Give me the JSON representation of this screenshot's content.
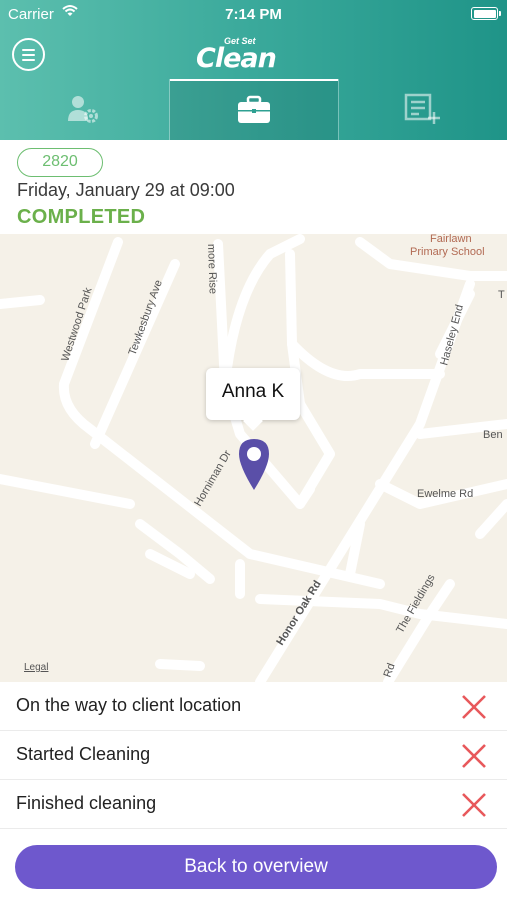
{
  "status_bar": {
    "carrier": "Carrier",
    "time": "7:14 PM"
  },
  "header": {
    "logo_small": "Get Set",
    "logo_big": "Clean",
    "tabs": [
      {
        "name": "profile-settings",
        "icon": "user-gear-icon",
        "active": false
      },
      {
        "name": "jobs",
        "icon": "briefcase-icon",
        "active": true
      },
      {
        "name": "new-entry",
        "icon": "document-add-icon",
        "active": false
      }
    ]
  },
  "order": {
    "id": "2820",
    "datetime": "Friday, January 29 at 09:00",
    "status": "COMPLETED"
  },
  "map": {
    "callout_name": "Anna K",
    "legal": "Legal",
    "labels": {
      "fairlawn_1": "Fairlawn",
      "fairlawn_2": "Primary School",
      "westwood": "Westwood Park",
      "tewkesbury": "Tewkesbury Ave",
      "rise": "more Rise",
      "haseley": "Haseley End",
      "horniman": "Horniman Dr",
      "ewelme": "Ewelme Rd",
      "honor_oak": "Honor Oak Rd",
      "fieldings": "The Fieldings",
      "ben": "Ben",
      "t": "T",
      "rd": "Rd"
    }
  },
  "steps": [
    {
      "label": "On the way to client location",
      "done": false
    },
    {
      "label": "Started Cleaning",
      "done": false
    },
    {
      "label": "Finished cleaning",
      "done": false
    }
  ],
  "actions": {
    "back": "Back to overview"
  },
  "colors": {
    "header_start": "#5cbfae",
    "header_end": "#1f9488",
    "completed": "#6bb04b",
    "badge": "#6dbe71",
    "primary_button": "#6e58cd",
    "pin": "#5a4fa8",
    "not_done_x": "#e8585b"
  }
}
